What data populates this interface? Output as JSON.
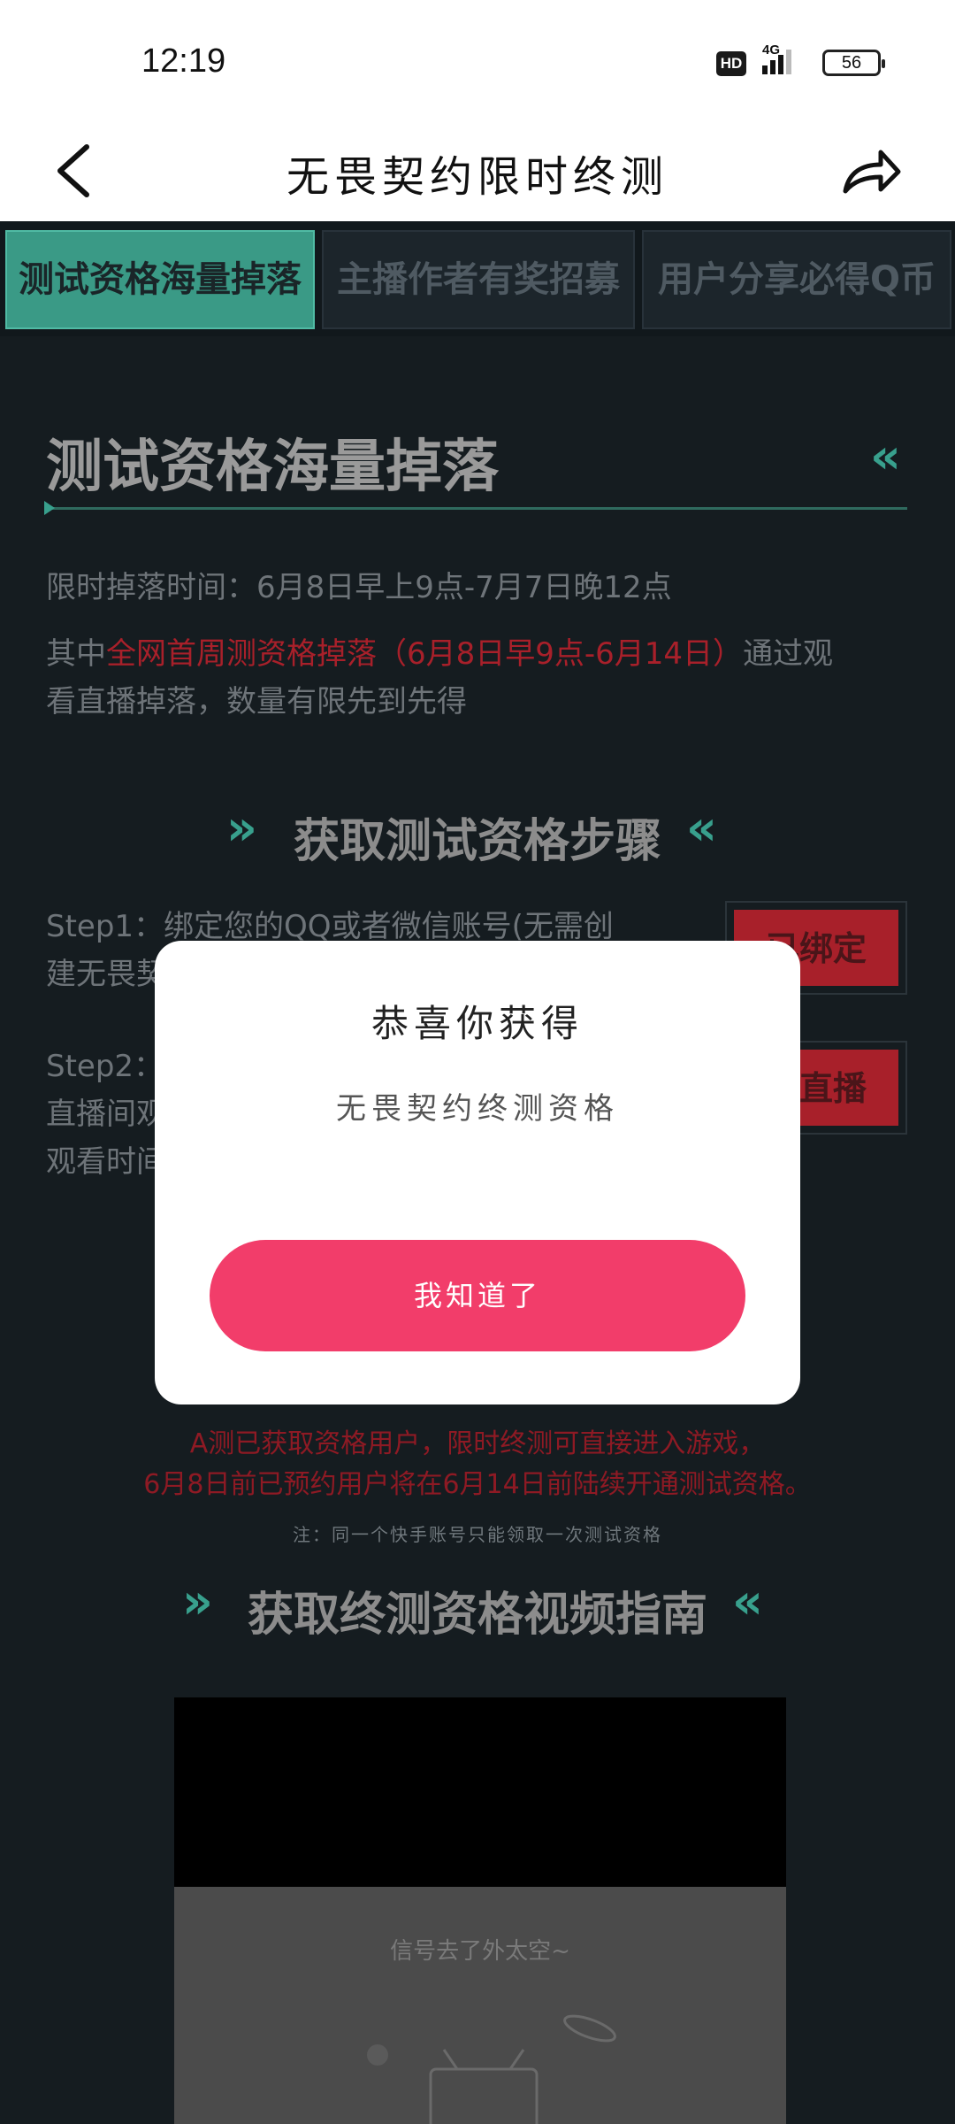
{
  "status_bar": {
    "time": "12:19",
    "hd": "HD",
    "network": "4G",
    "battery": "56"
  },
  "header": {
    "title": "无畏契约限时终测"
  },
  "tabs": [
    {
      "label": "测试资格海量掉落"
    },
    {
      "label": "主播作者有奖招募"
    },
    {
      "label": "用户分享必得Q币"
    }
  ],
  "section": {
    "title": "测试资格海量掉落",
    "time_line": "限时掉落时间：6月8日早上9点-7月7日晚12点",
    "para_prefix": "其中",
    "para_highlight": "全网首周测资格掉落（6月8日早9点-6月14日）",
    "para_suffix_1": "通过观",
    "para_suffix_2": "看直播掉落，数量有限先到先得"
  },
  "steps": {
    "title": "获取测试资格步骤",
    "step1_line1": "Step1：绑定您的QQ或者微信账号(无需创",
    "step1_line2": "建无畏契",
    "step1_button": "已绑定",
    "step2_line1": "Step2：",
    "step2_line2": "直播间观",
    "step2_line3": "观看时间",
    "step2_button": "看直播"
  },
  "notes": {
    "red_line1": "A测已获取资格用户，限时终测可直接进入游戏，",
    "red_line2": "6月8日前已预约用户将在6月14日前陆续开通测试资格。",
    "small": "注：同一个快手账号只能领取一次测试资格"
  },
  "video_guide": {
    "title": "获取终测资格视频指南",
    "message": "信号去了外太空~"
  },
  "modal": {
    "title": "恭喜你获得",
    "subtitle": "无畏契约终测资格",
    "button": "我知道了"
  },
  "colors": {
    "accent_green": "#38a08d",
    "highlight_red": "#a8202a",
    "modal_button": "#f23d6a"
  }
}
